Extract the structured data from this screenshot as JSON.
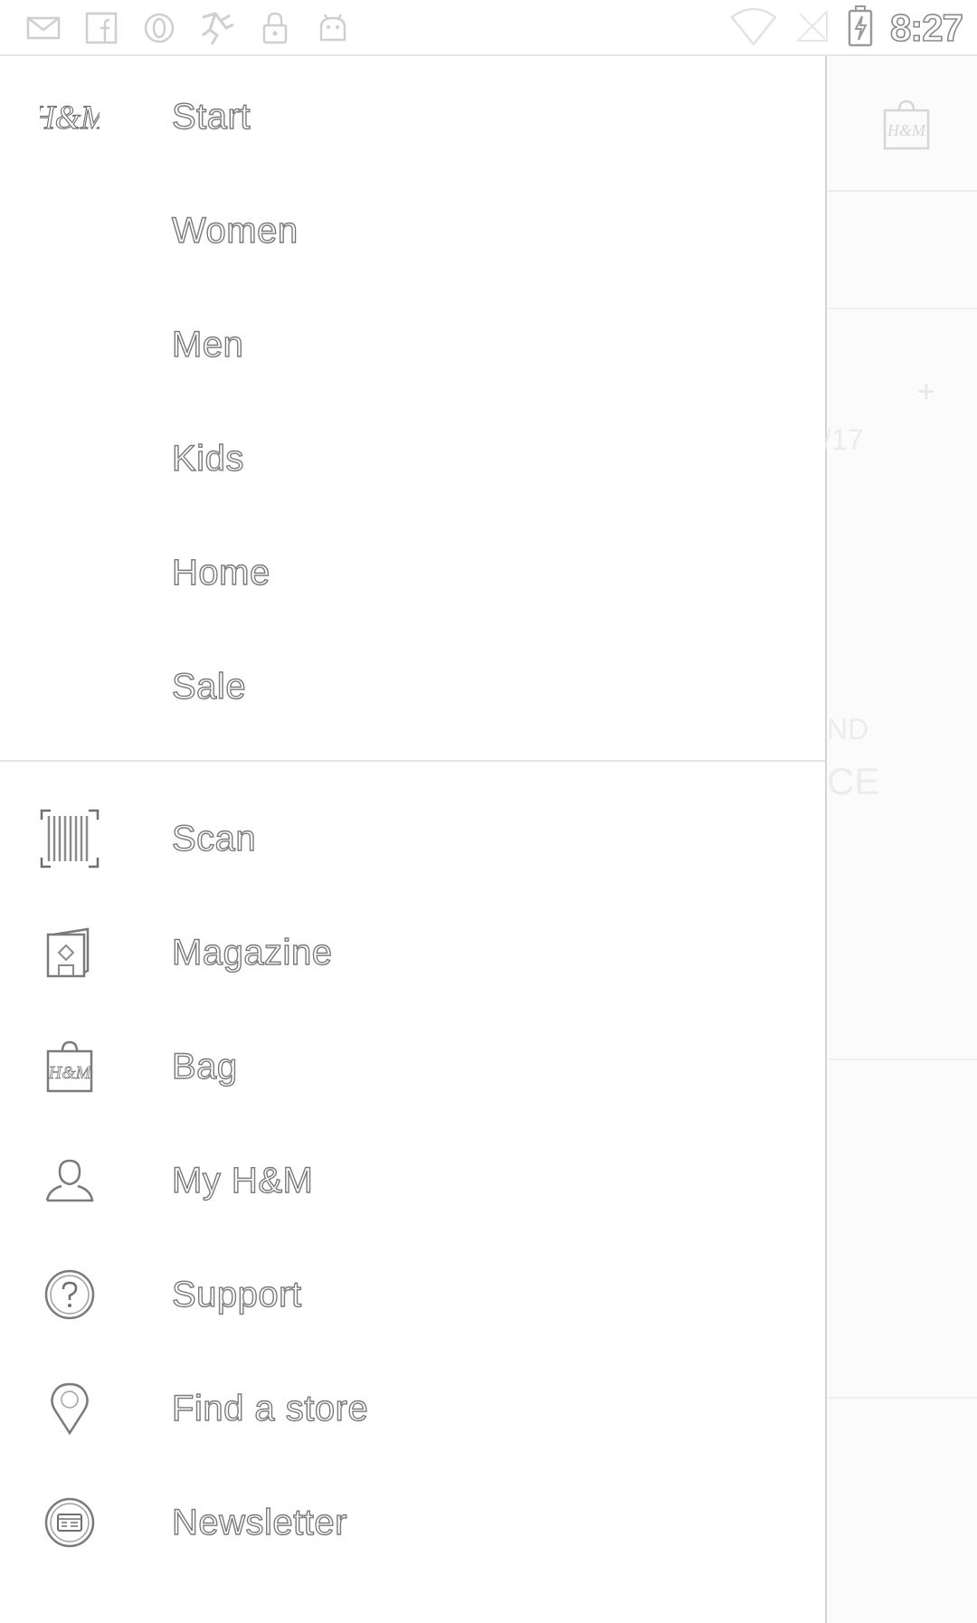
{
  "status_bar": {
    "time": "8:27",
    "left_icons": [
      "email-icon",
      "facebook-icon",
      "opera-icon",
      "runner-icon",
      "lock-icon",
      "android-icon"
    ],
    "right_icons": [
      "wifi-icon",
      "no-signal-icon",
      "battery-charging-icon"
    ]
  },
  "drawer": {
    "primary": [
      {
        "label": "Start",
        "icon": "hm-logo-icon"
      },
      {
        "label": "Women"
      },
      {
        "label": "Men"
      },
      {
        "label": "Kids"
      },
      {
        "label": "Home"
      },
      {
        "label": "Sale"
      }
    ],
    "secondary": [
      {
        "label": "Scan",
        "icon": "barcode-scan-icon"
      },
      {
        "label": "Magazine",
        "icon": "magazine-icon"
      },
      {
        "label": "Bag",
        "icon": "shopping-bag-icon"
      },
      {
        "label": "My H&M",
        "icon": "user-icon"
      },
      {
        "label": "Support",
        "icon": "help-icon"
      },
      {
        "label": "Find a store",
        "icon": "location-pin-icon"
      },
      {
        "label": "Newsletter",
        "icon": "newsletter-icon"
      }
    ]
  },
  "logo_text": "H&M",
  "background": {
    "bag_icon": "shopping-bag-icon",
    "bag_text": "H&M",
    "fragments": [
      "+",
      "/17",
      "ND",
      "CE"
    ]
  }
}
